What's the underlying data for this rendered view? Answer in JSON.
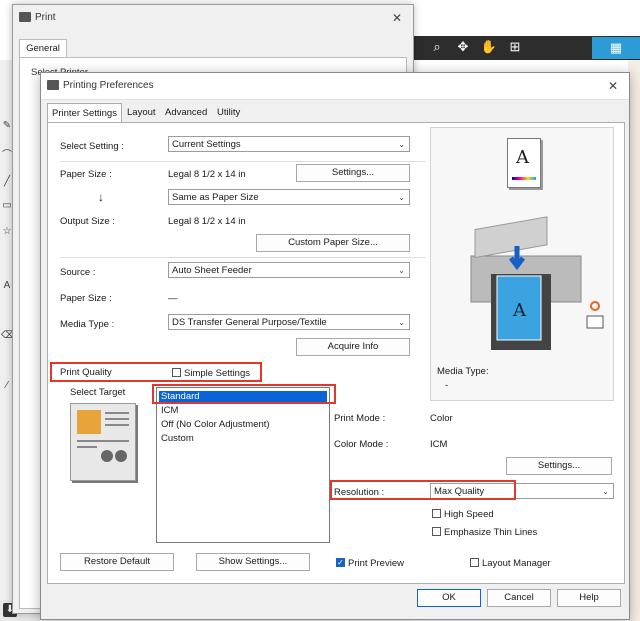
{
  "print_dialog": {
    "title": "Print",
    "tab": "General",
    "ghost_label": "Select Printer"
  },
  "pref_dialog": {
    "title": "Printing Preferences",
    "tabs": [
      "Printer Settings",
      "Layout",
      "Advanced",
      "Utility"
    ],
    "select_setting": {
      "label": "Select Setting :",
      "value": "Current Settings"
    },
    "paper_size": {
      "label": "Paper Size :",
      "value": "Legal 8 1/2 x 14 in",
      "settings_button": "Settings...",
      "arrow": "↓",
      "output_select": "Same as Paper Size"
    },
    "output_size": {
      "label": "Output Size :",
      "value": "Legal 8 1/2 x 14 in",
      "custom_button": "Custom Paper Size..."
    },
    "source": {
      "label": "Source :",
      "value": "Auto Sheet Feeder"
    },
    "paper_size2": {
      "label": "Paper Size :",
      "value": "—"
    },
    "media_type": {
      "label": "Media Type :",
      "value": "DS Transfer General Purpose/Textile",
      "acquire_button": "Acquire Info"
    },
    "print_quality": {
      "label": "Print Quality",
      "simple_settings": "Simple Settings",
      "select_target": "Select Target"
    },
    "targets": [
      "Standard",
      "ICM",
      "Off (No Color Adjustment)",
      "Custom"
    ],
    "preview": {
      "media_type_label": "Media Type:",
      "media_type_value": "-",
      "doc_letter": "A"
    },
    "print_mode": {
      "label": "Print Mode :",
      "value": "Color"
    },
    "color_mode": {
      "label": "Color Mode :",
      "value": "ICM",
      "settings_button": "Settings..."
    },
    "resolution": {
      "label": "Resolution :",
      "value": "Max Quality"
    },
    "high_speed": "High Speed",
    "emphasize": "Emphasize Thin Lines",
    "restore_default": "Restore Default",
    "show_settings": "Show Settings...",
    "print_preview": "Print Preview",
    "layout_manager": "Layout Manager",
    "ok": "OK",
    "cancel": "Cancel",
    "help": "Help"
  },
  "colors": {
    "highlight": "#e0392b",
    "selection": "#0a64d8",
    "accent": "#2d9bd6"
  }
}
